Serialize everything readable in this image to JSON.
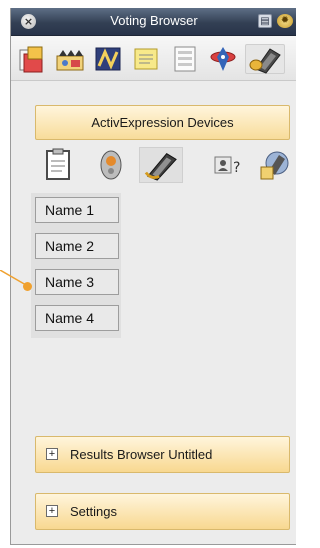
{
  "window": {
    "title": "Voting Browser"
  },
  "toolbar": {
    "tools": [
      "resource-browser-icon",
      "media-browser-icon",
      "page-browser-icon",
      "notes-browser-icon",
      "property-browser-icon",
      "action-browser-icon",
      "voting-browser-icon"
    ]
  },
  "panel": {
    "header": "ActivExpression Devices",
    "devices": [
      "clipboard-icon",
      "activote-device-icon",
      "activexpression-device-icon",
      "unknown-user-icon",
      "device-registration-icon"
    ],
    "names": [
      "Name 1",
      "Name 2",
      "Name 3",
      "Name 4"
    ]
  },
  "accordions": {
    "results": {
      "icon": "+",
      "label": "Results Browser Untitled"
    },
    "settings": {
      "icon": "+",
      "label": "Settings"
    }
  },
  "colors": {
    "titlebar": "#334054",
    "panel_header": "#f8dc9a",
    "pointer": "#f0a12f"
  }
}
